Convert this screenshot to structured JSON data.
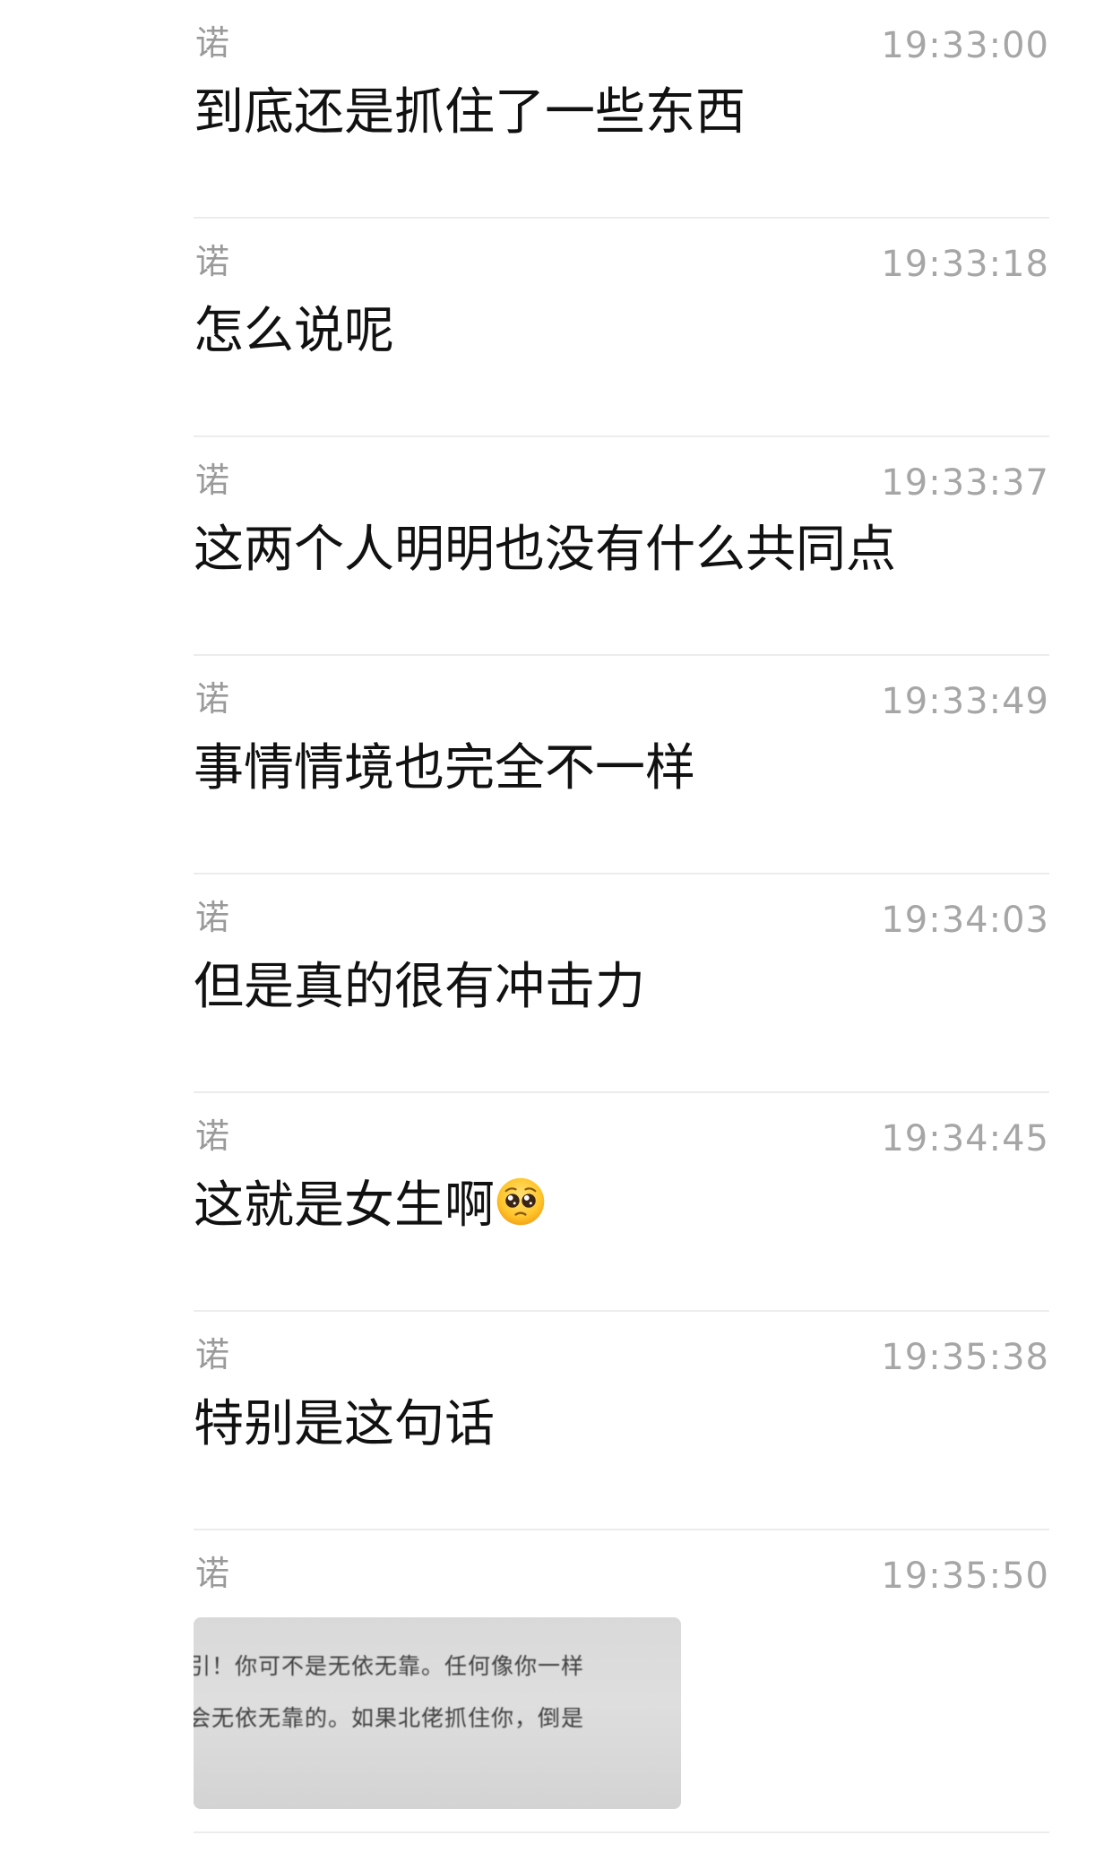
{
  "messages": [
    {
      "sender": "诺",
      "time": "19:33:00",
      "text": "到底还是抓住了一些东西"
    },
    {
      "sender": "诺",
      "time": "19:33:18",
      "text": "怎么说呢"
    },
    {
      "sender": "诺",
      "time": "19:33:37",
      "text": "这两个人明明也没有什么共同点"
    },
    {
      "sender": "诺",
      "time": "19:33:49",
      "text": "事情情境也完全不一样"
    },
    {
      "sender": "诺",
      "time": "19:34:03",
      "text": "但是真的很有冲击力"
    },
    {
      "sender": "诺",
      "time": "19:34:45",
      "text": "这就是女生啊",
      "emoji": "pleading-face"
    },
    {
      "sender": "诺",
      "time": "19:35:38",
      "text": "特别是这句话"
    },
    {
      "sender": "诺",
      "time": "19:35:50",
      "image": {
        "line1": "引！你可不是无依无靠。任何像你一样",
        "line2": "会无依无靠的。如果北佬抓住你，倒是"
      }
    }
  ]
}
